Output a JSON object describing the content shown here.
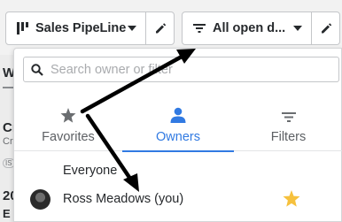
{
  "toolbar": {
    "pipeline_label": "Sales PipeLine",
    "filter_label": "All open d..."
  },
  "background_fragments": {
    "w": "W",
    "cr_bold": "Cr",
    "cr_gray": "Cr",
    "badge": "IS",
    "num": "20",
    "e": "E"
  },
  "dropdown": {
    "search_placeholder": "Search owner or filter",
    "tabs": [
      {
        "label": "Favorites",
        "icon": "star-icon"
      },
      {
        "label": "Owners",
        "icon": "person-icon",
        "active": true
      },
      {
        "label": "Filters",
        "icon": "filter-icon"
      }
    ],
    "everyone_label": "Everyone",
    "owner": {
      "name": "Ross Meadows (you)",
      "favorite": true
    }
  },
  "colors": {
    "accent": "#317ae2",
    "star_favorite": "#f6c13d",
    "annotation_arrow": "#000000"
  }
}
